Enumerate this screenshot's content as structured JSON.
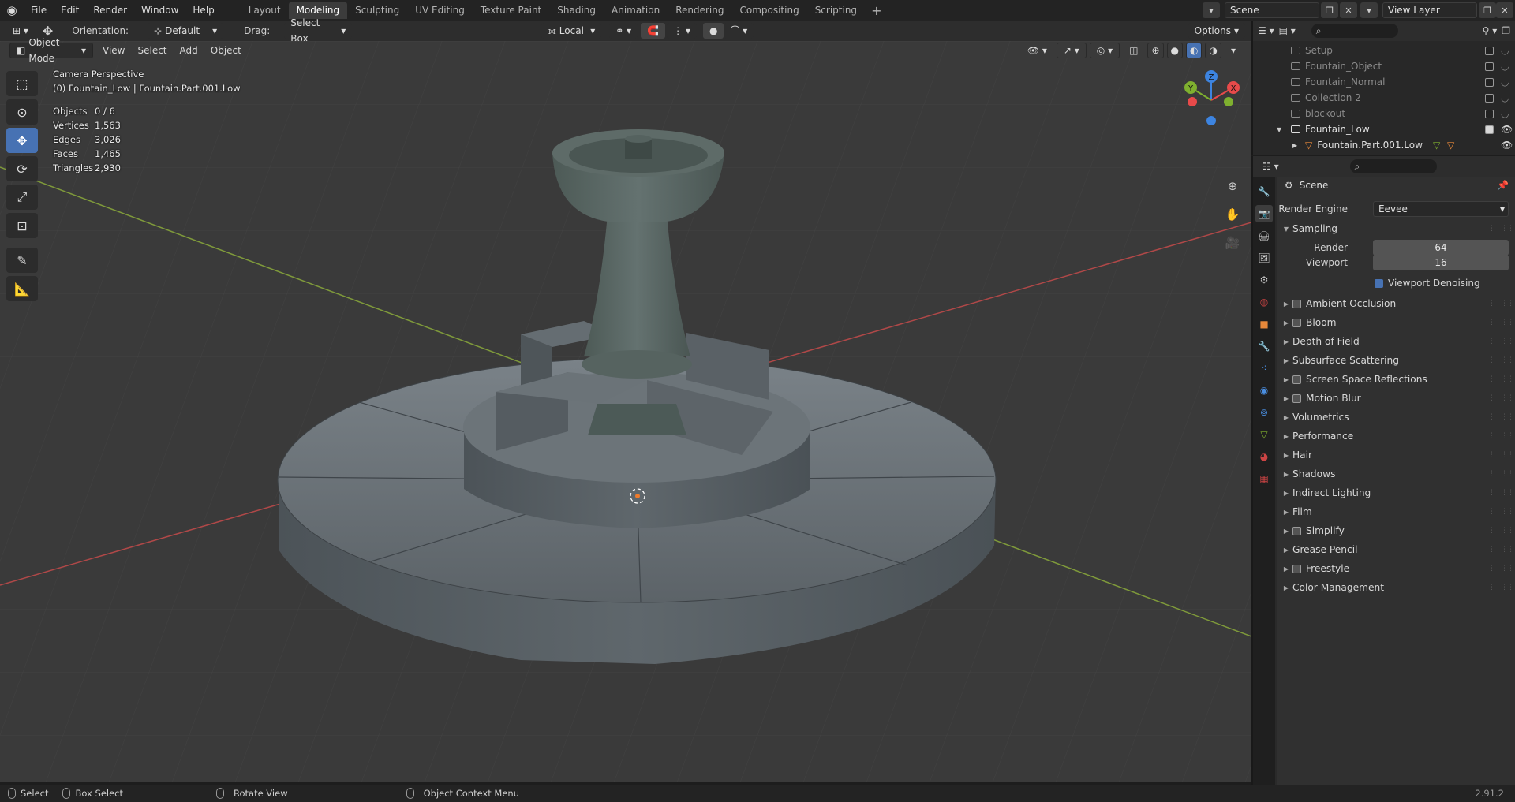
{
  "topbar": {
    "menus": [
      "File",
      "Edit",
      "Render",
      "Window",
      "Help"
    ],
    "workspaces": [
      "Layout",
      "Modeling",
      "Sculpting",
      "UV Editing",
      "Texture Paint",
      "Shading",
      "Animation",
      "Rendering",
      "Compositing",
      "Scripting"
    ],
    "active_workspace": "Modeling",
    "scene_name": "Scene",
    "view_layer": "View Layer"
  },
  "tool_header": {
    "orientation_label": "Orientation:",
    "orientation_value": "Default",
    "drag_label": "Drag:",
    "drag_value": "Select Box",
    "pivot_value": "Local",
    "options_label": "Options"
  },
  "viewport_header": {
    "mode": "Object Mode",
    "menus": [
      "View",
      "Select",
      "Add",
      "Object"
    ]
  },
  "overlay": {
    "view_name": "Camera Perspective",
    "object_info": "(0) Fountain_Low | Fountain.Part.001.Low",
    "stats": [
      {
        "label": "Objects",
        "value": "0 / 6"
      },
      {
        "label": "Vertices",
        "value": "1,563"
      },
      {
        "label": "Edges",
        "value": "3,026"
      },
      {
        "label": "Faces",
        "value": "1,465"
      },
      {
        "label": "Triangles",
        "value": "2,930"
      }
    ]
  },
  "gizmo": {
    "x": "X",
    "y": "Y",
    "z": "Z"
  },
  "outliner": {
    "rows": [
      {
        "name": "Setup",
        "checked": false
      },
      {
        "name": "Fountain_Object",
        "checked": false
      },
      {
        "name": "Fountain_Normal",
        "checked": false
      },
      {
        "name": "Collection 2",
        "checked": false
      },
      {
        "name": "blockout",
        "checked": false
      },
      {
        "name": "Fountain_Low",
        "checked": true
      },
      {
        "name": "Fountain.Part.001.Low",
        "checked": null
      }
    ]
  },
  "properties": {
    "context_title": "Scene",
    "render_engine_label": "Render Engine",
    "render_engine_value": "Eevee",
    "sampling": {
      "title": "Sampling",
      "render_label": "Render",
      "render_value": "64",
      "viewport_label": "Viewport",
      "viewport_value": "16",
      "denoise_label": "Viewport Denoising",
      "denoise_checked": true
    },
    "sections": [
      {
        "label": "Ambient Occlusion",
        "checkbox": true
      },
      {
        "label": "Bloom",
        "checkbox": true
      },
      {
        "label": "Depth of Field",
        "checkbox": false
      },
      {
        "label": "Subsurface Scattering",
        "checkbox": false
      },
      {
        "label": "Screen Space Reflections",
        "checkbox": true
      },
      {
        "label": "Motion Blur",
        "checkbox": true
      },
      {
        "label": "Volumetrics",
        "checkbox": false
      },
      {
        "label": "Performance",
        "checkbox": false
      },
      {
        "label": "Hair",
        "checkbox": false
      },
      {
        "label": "Shadows",
        "checkbox": false
      },
      {
        "label": "Indirect Lighting",
        "checkbox": false
      },
      {
        "label": "Film",
        "checkbox": false
      },
      {
        "label": "Simplify",
        "checkbox": true
      },
      {
        "label": "Grease Pencil",
        "checkbox": false
      },
      {
        "label": "Freestyle",
        "checkbox": true
      },
      {
        "label": "Color Management",
        "checkbox": false
      }
    ]
  },
  "statusbar": {
    "select": "Select",
    "box_select": "Box Select",
    "rotate_view": "Rotate View",
    "context_menu": "Object Context Menu",
    "version": "2.91.2"
  },
  "colors": {
    "accent": "#4772b3",
    "x_axis": "#e84a4a",
    "y_axis": "#7fb02f",
    "z_axis": "#3d84e0"
  }
}
